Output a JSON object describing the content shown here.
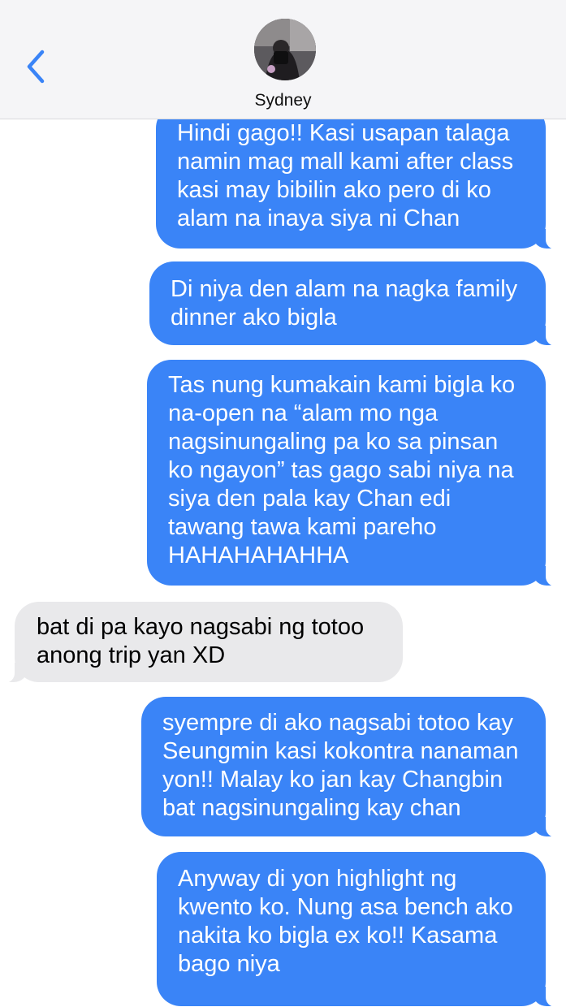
{
  "header": {
    "contact_name": "Sydney",
    "back_icon": "chevron-left-icon",
    "accent_color": "#3A84F7"
  },
  "messages": [
    {
      "sender": "me",
      "lines": [
        "Hindi gago!! Kasi usapan talaga",
        "namin mag mall kami after class",
        "kasi may bibilin ako pero di ko",
        "alam na inaya siya ni Chan"
      ]
    },
    {
      "sender": "me",
      "lines": [
        "Di niya den alam na nagka family",
        "dinner ako bigla"
      ]
    },
    {
      "sender": "me",
      "lines": [
        "Tas nung kumakain kami bigla ko",
        "na-open na “alam mo nga",
        "nagsinungaling pa ko sa pinsan",
        "ko ngayon” tas gago sabi niya na",
        "siya den pala kay Chan edi",
        "tawang tawa kami pareho",
        "HAHAHAHAHHA"
      ]
    },
    {
      "sender": "them",
      "lines": [
        "bat di pa kayo nagsabi ng totoo",
        "anong trip yan XD"
      ]
    },
    {
      "sender": "me",
      "lines": [
        "syempre di ako nagsabi totoo kay",
        "Seungmin kasi kokontra nanaman",
        "yon!! Malay ko jan kay Changbin",
        "bat nagsinungaling kay chan"
      ]
    },
    {
      "sender": "me",
      "lines": [
        "Anyway di yon highlight ng",
        "kwento ko. Nung asa bench ako",
        "nakita ko bigla ex ko!! Kasama",
        "bago niya"
      ]
    }
  ]
}
